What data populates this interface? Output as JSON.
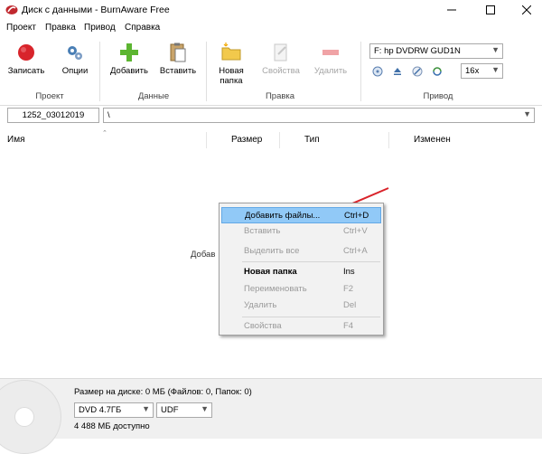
{
  "window": {
    "title": "Диск с данными - BurnAware Free"
  },
  "menu": [
    "Проект",
    "Правка",
    "Привод",
    "Справка"
  ],
  "ribbon": {
    "project": {
      "label": "Проект",
      "burn": "Записать",
      "options": "Опции"
    },
    "data": {
      "label": "Данные",
      "add": "Добавить",
      "insert": "Вставить"
    },
    "edit": {
      "label": "Правка",
      "new_folder": "Новая папка",
      "properties": "Свойства",
      "delete": "Удалить"
    },
    "drive": {
      "label": "Привод",
      "device": "F: hp DVDRW GUD1N",
      "speed": "16x"
    }
  },
  "pathbar": {
    "volume_label": "1252_03012019",
    "path": "\\"
  },
  "columns": [
    "Имя",
    "Размер",
    "Тип",
    "Изменен"
  ],
  "list": {
    "hint_partial": "Добав"
  },
  "context_menu": [
    {
      "label": "Добавить файлы...",
      "shortcut": "Ctrl+D",
      "state": "highlighted"
    },
    {
      "label": "Вставить",
      "shortcut": "Ctrl+V",
      "state": "disabled"
    },
    {
      "label": "Выделить все",
      "shortcut": "Ctrl+A",
      "state": "disabled"
    },
    {
      "label": "Новая папка",
      "shortcut": "Ins",
      "state": "bold"
    },
    {
      "label": "Переименовать",
      "shortcut": "F2",
      "state": "disabled"
    },
    {
      "label": "Удалить",
      "shortcut": "Del",
      "state": "disabled"
    },
    {
      "label": "Свойства",
      "shortcut": "F4",
      "state": "disabled"
    }
  ],
  "status": {
    "size_info": "Размер на диске: 0 МБ (Файлов: 0, Папок: 0)",
    "disc_type": "DVD 4.7ГБ",
    "filesystem": "UDF",
    "available": "4 488 МБ доступно"
  },
  "colors": {
    "highlight": "#91c9f7",
    "annotation_arrow": "#d9232a"
  }
}
